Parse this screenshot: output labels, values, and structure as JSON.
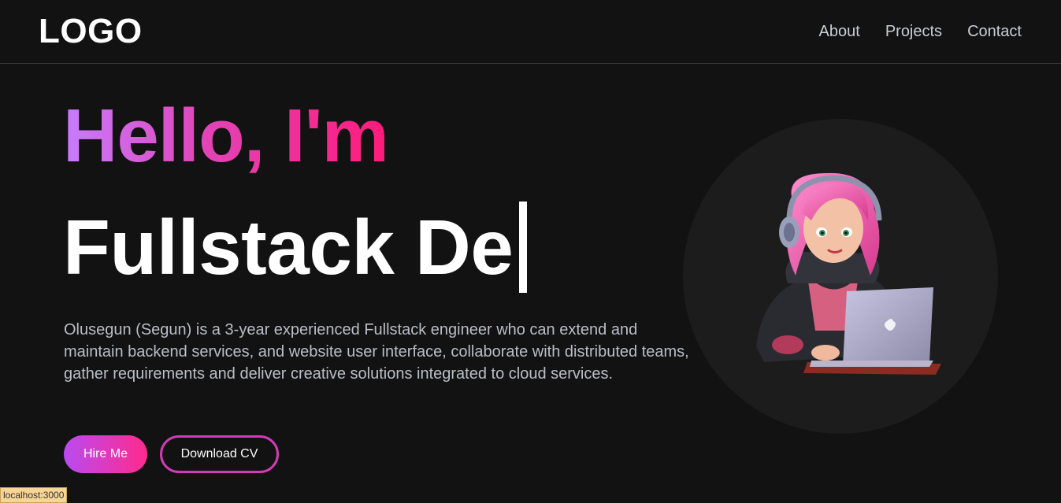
{
  "navbar": {
    "logo": "LOGO",
    "links": [
      "About",
      "Projects",
      "Contact"
    ]
  },
  "hero": {
    "greeting": "Hello, I'm",
    "role_typed": "Fullstack De",
    "description": "Olusegun (Segun) is a 3-year experienced Fullstack engineer who can extend and maintain backend services, and website user interface, collaborate with distributed teams, gather requirements and deliver creative solutions integrated to cloud services.",
    "hire_button": "Hire Me",
    "download_button": "Download CV"
  },
  "status_bar": {
    "url": "localhost:3000"
  },
  "colors": {
    "background": "#121212",
    "gradient_start": "#c77dff",
    "gradient_end": "#ff1b7a",
    "accent_border": "#d33bb4"
  }
}
